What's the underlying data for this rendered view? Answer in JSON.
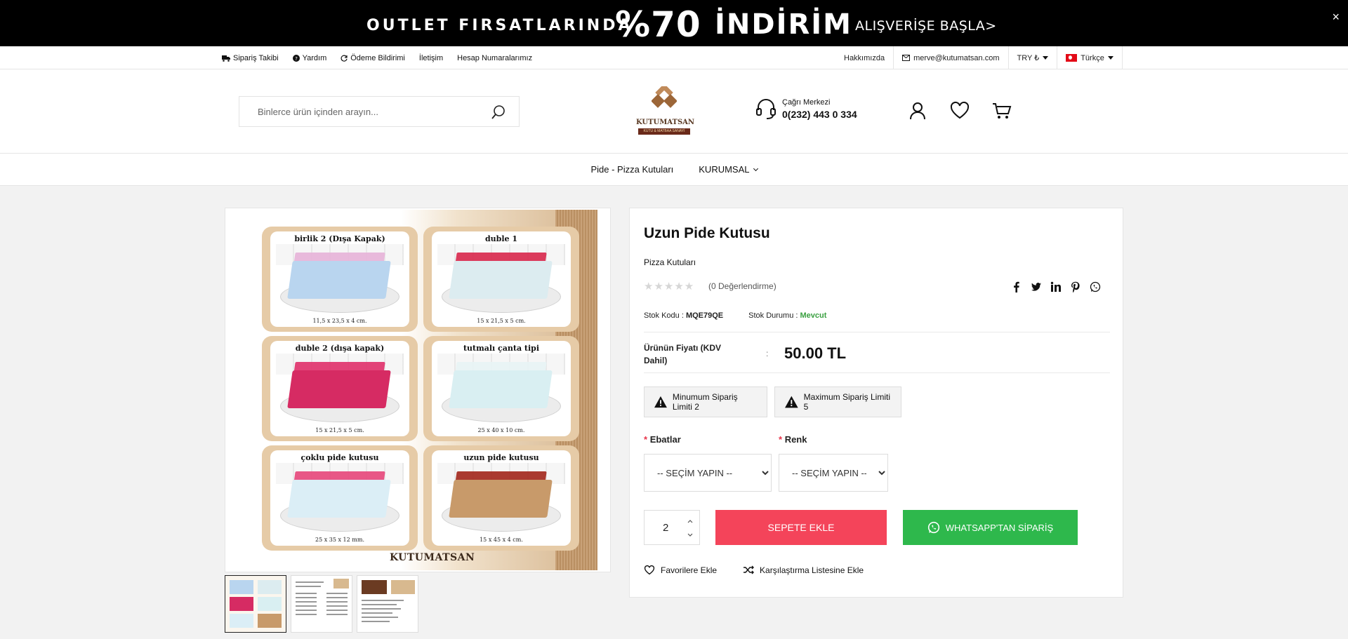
{
  "banner": {
    "part1": "OUTLET FIRSATLARINDA",
    "part2": "%70",
    "part3": "İNDİRİM",
    "cta": "ALIŞVERİŞE BAŞLA>",
    "close": "×",
    "colors": {
      "background": "#000000",
      "text": "#ffffff"
    }
  },
  "util_bar": {
    "left_links": [
      {
        "label": "Sipariş Takibi",
        "icon": "truck-icon"
      },
      {
        "label": "Yardım",
        "icon": "help-circle-icon"
      },
      {
        "label": "Ödeme Bildirimi",
        "icon": "refresh-icon"
      },
      {
        "label": "İletişim",
        "icon": ""
      },
      {
        "label": "Hesap Numaralarımız",
        "icon": ""
      }
    ],
    "about": "Hakkımızda",
    "email": "merve@kutumatsan.com",
    "currency": "TRY ₺",
    "language": "Türkçe"
  },
  "header": {
    "search_placeholder": "Binlerce ürün içinden arayın...",
    "logo_name": "KUTUMATSAN",
    "logo_sub": "KUTU & MATBAA SANAYİ",
    "call_center_label": "Çağrı Merkezi",
    "call_center_phone": "0(232) 443 0 334",
    "icons": [
      "user-icon",
      "heart-icon",
      "cart-icon"
    ]
  },
  "nav": {
    "items": [
      {
        "label": "Pide - Pizza Kutuları"
      },
      {
        "label": "KURUMSAL"
      }
    ]
  },
  "gallery": {
    "cards": [
      {
        "title": "birlik 2 (Dışa Kapak)",
        "dim": "11,5 x 23,5 x 4 cm."
      },
      {
        "title": "duble 1",
        "dim": "15 x 21,5 x 5 cm."
      },
      {
        "title": "duble 2 (dışa kapak)",
        "dim": "15 x 21,5 x 5 cm."
      },
      {
        "title": "tutmalı çanta tipi",
        "dim": "25 x 40 x 10 cm."
      },
      {
        "title": "çoklu pide kutusu",
        "dim": "25 x 35 x 12 mm."
      },
      {
        "title": "uzun pide kutusu",
        "dim": "15 x 45 x 4 cm."
      }
    ],
    "brand": "KUTUMATSAN",
    "thumb_count": 3
  },
  "product": {
    "title": "Uzun Pide Kutusu",
    "category": "Pizza Kutuları",
    "stars": "★★★★★",
    "rating_text": "(0 Değerlendirme)",
    "share_icons": [
      "facebook-icon",
      "twitter-icon",
      "linkedin-icon",
      "pinterest-icon",
      "whatsapp-icon"
    ],
    "stock_code_label": "Stok Kodu :",
    "stock_code": "MQE79QE",
    "stock_status_label": "Stok Durumu :",
    "stock_status": "Mevcut",
    "price_label": "Ürünün Fiyatı (KDV Dahil)",
    "price_colon": ":",
    "price": "50.00 TL",
    "min_limit": "Minumum Sipariş Limiti 2",
    "max_limit": "Maximum Sipariş Limiti 5",
    "option1_label": "Ebatlar",
    "option2_label": "Renk",
    "required_mark": "*",
    "select_placeholder": "-- SEÇİM YAPIN --",
    "quantity": "2",
    "add_to_cart": "SEPETE EKLE",
    "whatsapp_order": "WHATSAPP'TAN SİPARİŞ",
    "favorite": "Favorilere Ekle",
    "compare": "Karşılaştırma Listesine Ekle",
    "colors": {
      "cart_button": "#f4445a",
      "whatsapp_button": "#2eb84c",
      "in_stock": "#3aa041"
    }
  }
}
